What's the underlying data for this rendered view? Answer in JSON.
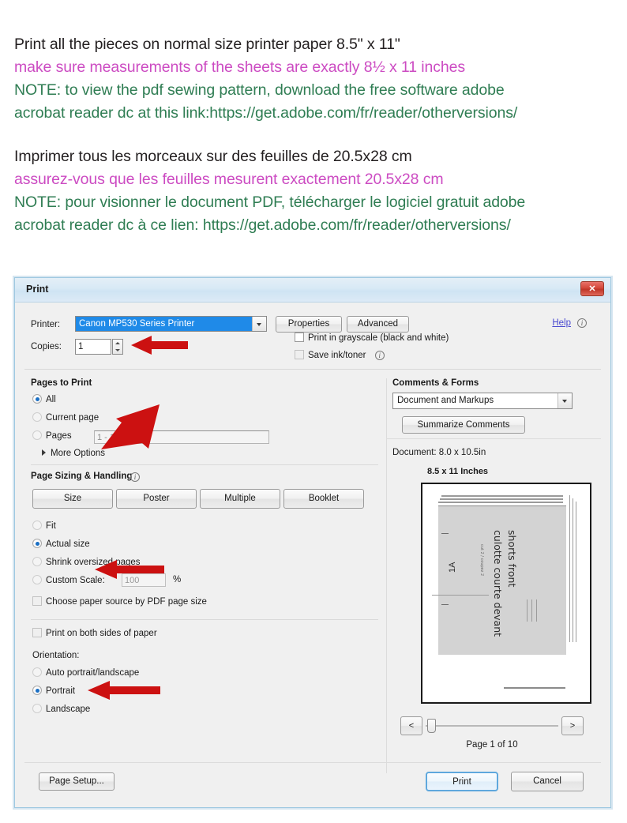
{
  "instructions": {
    "english": [
      {
        "text": "Print all the pieces on normal size printer paper 8.5\" x 11\"",
        "color": "#231f20"
      },
      {
        "text": "make sure measurements of the sheets are exactly 8½ x 11 inches",
        "color": "#cc4bc2"
      },
      {
        "text": "NOTE: to view the pdf sewing pattern, download the free software adobe",
        "color": "#2f7d53"
      },
      {
        "text": "acrobat reader dc at this link:https://get.adobe.com/fr/reader/otherversions/",
        "color": "#2f7d53"
      }
    ],
    "french": [
      {
        "text": "Imprimer tous les morceaux sur des feuilles de 20.5x28 cm",
        "color": "#231f20"
      },
      {
        "text": "assurez-vous que les feuilles mesurent exactement 20.5x28 cm",
        "color": "#cc4bc2"
      },
      {
        "text": "NOTE: pour visionner le document PDF, télécharger le logiciel gratuit adobe",
        "color": "#2f7d53"
      },
      {
        "text": "acrobat reader dc à ce lien: https://get.adobe.com/fr/reader/otherversions/",
        "color": "#2f7d53"
      }
    ]
  },
  "dialog": {
    "title": "Print",
    "close_label": "✕",
    "printer": {
      "label": "Printer:",
      "selected": "Canon MP530 Series Printer",
      "properties_button": "Properties",
      "advanced_button": "Advanced"
    },
    "help": {
      "link": "Help",
      "info_icon": "i"
    },
    "copies": {
      "label": "Copies:",
      "value": "1"
    },
    "checkboxes": [
      {
        "label": "Print in grayscale (black and white)",
        "checked": false
      },
      {
        "label": "Save ink/toner",
        "checked": false,
        "has_info": true
      }
    ],
    "pages_to_print": {
      "title": "Pages to Print",
      "options": [
        {
          "label": "All",
          "selected": true
        },
        {
          "label": "Current page",
          "selected": false
        },
        {
          "label": "Pages",
          "selected": false
        }
      ],
      "pages_value": "1 - 10",
      "more_options": "More Options"
    },
    "page_sizing": {
      "title": "Page Sizing & Handling",
      "buttons": [
        "Size",
        "Poster",
        "Multiple",
        "Booklet"
      ],
      "options": [
        {
          "label": "Fit",
          "selected": false
        },
        {
          "label": "Actual size",
          "selected": true
        },
        {
          "label": "Shrink oversized pages",
          "selected": false
        },
        {
          "label": "Custom Scale:",
          "selected": false
        }
      ],
      "custom_scale_value": "100",
      "percent_symbol": "%",
      "paper_source_checkbox": {
        "label": "Choose paper source by PDF page size",
        "checked": false
      }
    },
    "duplex": {
      "label": "Print on both sides of paper",
      "checked": false
    },
    "orientation": {
      "title": "Orientation:",
      "options": [
        {
          "label": "Auto portrait/landscape",
          "selected": false
        },
        {
          "label": "Portrait",
          "selected": true
        },
        {
          "label": "Landscape",
          "selected": false
        }
      ]
    },
    "comments_forms": {
      "title": "Comments & Forms",
      "selected": "Document and Markups",
      "summarize_button": "Summarize Comments"
    },
    "preview": {
      "document_size": "Document: 8.0 x 10.5in",
      "paper_size": "8.5 x 11 Inches",
      "pattern_title_en": "shorts front",
      "pattern_title_fr": "culotte courte devant",
      "pattern_small_note": "cut 2 / coupez 2",
      "pattern_piece_label": "1A",
      "prev_button": "<",
      "next_button": ">",
      "page_indicator": "Page 1 of 10"
    },
    "footer": {
      "page_setup_button": "Page Setup...",
      "print_button": "Print",
      "cancel_button": "Cancel"
    }
  },
  "annotations": {
    "arrow_color": "#cc1111",
    "arrows": [
      "copies-arrow",
      "pages-arrow",
      "actual-size-arrow",
      "portrait-arrow"
    ]
  }
}
